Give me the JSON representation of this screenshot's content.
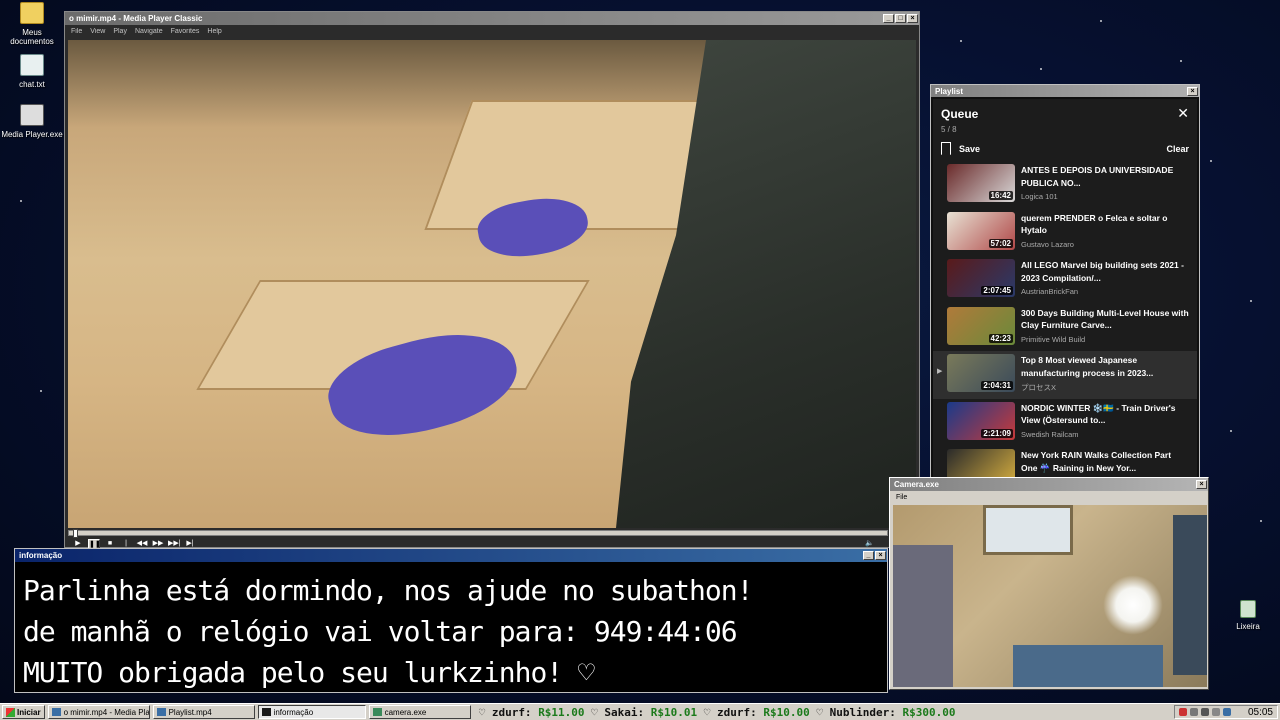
{
  "desktop": {
    "icons": [
      {
        "label": "Meus documentos",
        "icon": "folder-icon"
      },
      {
        "label": "chat.txt",
        "icon": "text-file-icon"
      },
      {
        "label": "Media Player.exe",
        "icon": "media-player-icon"
      }
    ],
    "recycle_label": "Lixeira"
  },
  "mpc": {
    "title": "o mimir.mp4 - Media Player Classic",
    "menu": [
      "File",
      "View",
      "Play",
      "Navigate",
      "Favorites",
      "Help"
    ],
    "controls": {
      "play": "▶",
      "pause": "❚❚",
      "stop": "■",
      "prev": "|◀◀",
      "rew": "◀◀",
      "ffw": "▶▶",
      "next": "▶▶|",
      "frame": "▶|",
      "volume": "🔈"
    }
  },
  "info": {
    "title": "informação",
    "lines": [
      "Parlinha está dormindo, nos ajude no subathon!",
      "de manhã o relógio vai voltar para:  949:44:06",
      "MUITO obrigada pelo seu lurkzinho! ♡"
    ]
  },
  "playlist": {
    "window_title": "Playlist",
    "heading": "Queue",
    "count": "5 / 8",
    "save_label": "Save",
    "clear_label": "Clear",
    "items": [
      {
        "title": "ANTES E DEPOIS DA UNIVERSIDADE PUBLICA NO...",
        "channel": "Logica 101",
        "duration": "16:42",
        "colors": [
          "#6a2a2a",
          "#d9d9d9"
        ]
      },
      {
        "title": "querem PRENDER o Felca e soltar o Hytalo",
        "channel": "Gustavo Lazaro",
        "duration": "57:02",
        "colors": [
          "#e8e2d4",
          "#b04848"
        ]
      },
      {
        "title": "All LEGO Marvel big building sets 2021 - 2023 Compilation/...",
        "channel": "AustrianBrickFan",
        "duration": "2:07:45",
        "colors": [
          "#5a1a1a",
          "#2a3a6a"
        ]
      },
      {
        "title": "300 Days Building Multi-Level House with Clay Furniture Carve...",
        "channel": "Primitive Wild Build",
        "duration": "42:23",
        "colors": [
          "#b07a3a",
          "#6a8a3a"
        ]
      },
      {
        "title": "Top 8 Most viewed Japanese manufacturing process in 2023...",
        "channel": "プロセスX",
        "duration": "2:04:31",
        "colors": [
          "#7a7a5a",
          "#3a4a5a"
        ],
        "current": true
      },
      {
        "title": "NORDIC WINTER ❄️🇸🇪 - Train Driver's View (Östersund to...",
        "channel": "Swedish Railcam",
        "duration": "2:21:09",
        "colors": [
          "#1a3a8a",
          "#c83a3a"
        ]
      },
      {
        "title": "New York RAIN Walks Collection Part One ☔ Raining in New Yor...",
        "channel": "",
        "duration": "",
        "colors": [
          "#2a2a2a",
          "#d8b040"
        ]
      }
    ]
  },
  "camera": {
    "title": "Camera.exe",
    "menu": [
      "File"
    ]
  },
  "taskbar": {
    "start_label": "Iniciar",
    "tasks": [
      {
        "label": "o mimir.mp4 - Media Playe...",
        "active": false
      },
      {
        "label": "Playlist.mp4",
        "active": false
      },
      {
        "label": "informação",
        "active": true
      },
      {
        "label": "camera.exe",
        "active": false
      }
    ],
    "ticker": [
      {
        "name": "♡ zdurf:",
        "amount": "R$11.00"
      },
      {
        "name": "♡ Sakai:",
        "amount": "R$10.01"
      },
      {
        "name": "♡ zdurf:",
        "amount": "R$10.00"
      },
      {
        "name": "♡ Nublinder:",
        "amount": "R$300.00"
      }
    ],
    "clock": "05:05"
  }
}
